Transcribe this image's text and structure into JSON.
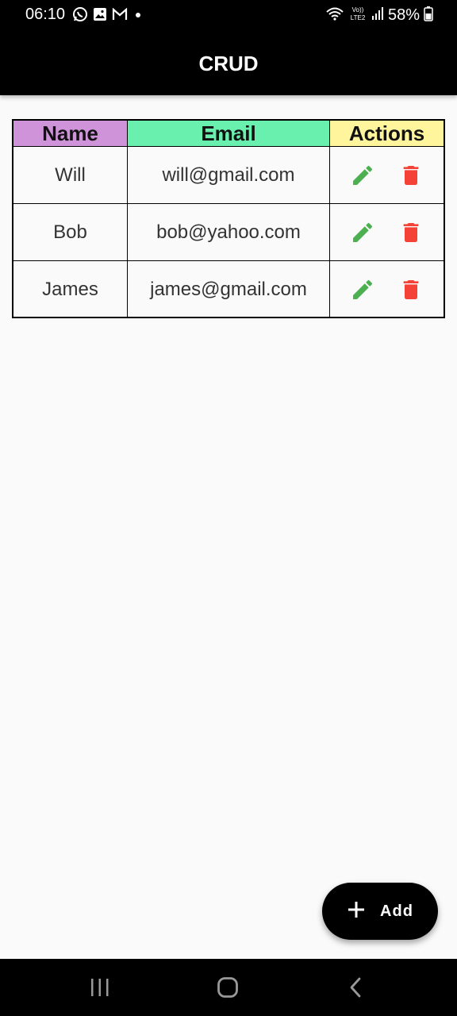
{
  "status_bar": {
    "time": "06:10",
    "battery": "58%",
    "network": "LTE2",
    "icons": [
      "whatsapp-icon",
      "gallery-icon",
      "gmail-icon",
      "notification-dot-icon",
      "wifi-icon",
      "volte-icon",
      "signal-icon",
      "battery-icon"
    ]
  },
  "app_bar": {
    "title": "CRUD"
  },
  "table": {
    "headers": {
      "name": "Name",
      "email": "Email",
      "actions": "Actions"
    },
    "header_colors": {
      "name": "#ce93d8",
      "email": "#69f0ae",
      "actions": "#fff59d"
    },
    "rows": [
      {
        "name": "Will",
        "email": "will@gmail.com"
      },
      {
        "name": "Bob",
        "email": "bob@yahoo.com"
      },
      {
        "name": "James",
        "email": "james@gmail.com"
      }
    ],
    "action_icons": {
      "edit": "edit-pencil-icon",
      "delete": "delete-trash-icon"
    },
    "action_colors": {
      "edit": "#4caf50",
      "delete": "#f44336"
    }
  },
  "fab": {
    "label": "Add",
    "icon": "plus-icon"
  },
  "nav_bar": {
    "icons": [
      "recent-apps-icon",
      "home-icon",
      "back-icon"
    ]
  }
}
